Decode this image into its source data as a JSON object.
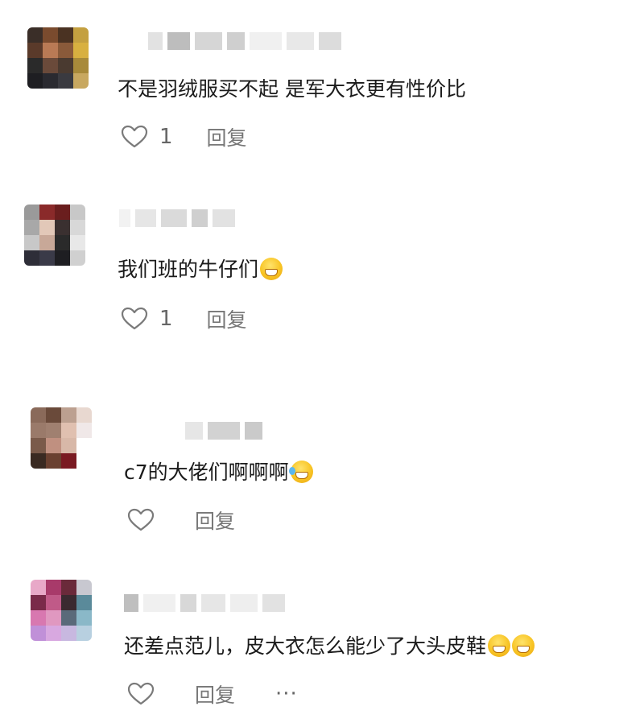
{
  "comments": [
    {
      "text": "不是羽绒服买不起 是军大衣更有性价比",
      "emoji": "",
      "like_count": "1",
      "reply_label": "回复",
      "avatar_colors": [
        "#3a2e28",
        "#7a4b2e",
        "#4a3222",
        "#c4a040",
        "#5a3a2a",
        "#b97a55",
        "#8a5a3a",
        "#d8b040",
        "#2a2a2a",
        "#6a4a3a",
        "#4a3a30",
        "#a88a3a",
        "#1e1e22",
        "#2a2a30",
        "#3a3a40",
        "#c8a860"
      ],
      "name_blocks": [
        "#e2e2e2",
        "#bdbdbd",
        "#d6d6d6",
        "#cfcfcf",
        "#f0f0f0",
        "#e8e8e8",
        "#dcdcdc"
      ]
    },
    {
      "text": "我们班的牛仔们",
      "emoji": "grin",
      "like_count": "1",
      "reply_label": "回复",
      "avatar_colors": [
        "#9a9a9a",
        "#8a2a2a",
        "#6a1e1e",
        "#c8c8c8",
        "#a8a8a8",
        "#e2c8b8",
        "#3a3030",
        "#d8d8d8",
        "#c8c8c8",
        "#c8a898",
        "#2a2a2a",
        "#e8e8e8",
        "#2e2e38",
        "#3a3a48",
        "#1e1e22",
        "#d0d0d0"
      ],
      "name_blocks": [
        "#f2f2f2",
        "#e6e6e6",
        "#dadada",
        "#cfcfcf",
        "#e2e2e2"
      ]
    },
    {
      "text": "c7的大佬们啊啊啊",
      "emoji": "laugh",
      "like_count": "",
      "reply_label": "回复",
      "avatar_colors": [
        "#8a6a5a",
        "#6a4a3a",
        "#bca090",
        "#e8d8d0",
        "#9a7a6a",
        "#a08070",
        "#e0c0b0",
        "#f0e8e8",
        "#7a5a4a",
        "#c09080",
        "#d8b8a8",
        "#ffffff",
        "#3a2a22",
        "#6a4030",
        "#7a1a22",
        "#ffffff"
      ],
      "name_blocks": [
        "#e6e6e6",
        "#d2d2d2",
        "#cacaca"
      ]
    },
    {
      "text": "还差点范儿，皮大衣怎么能少了大头皮鞋",
      "emoji": "grin2",
      "like_count": "",
      "reply_label": "回复",
      "more_label": "···",
      "avatar_colors": [
        "#e8a8c8",
        "#a83a6a",
        "#6a2a3a",
        "#c8c8d0",
        "#7a2a4a",
        "#c05a88",
        "#3a2a30",
        "#5a8a9a",
        "#d878b0",
        "#e098c0",
        "#5a6a7a",
        "#8ab8c8",
        "#c090d8",
        "#d8a8e0",
        "#c8b8e0",
        "#b8d0e0"
      ],
      "name_blocks": [
        "#bfbfbf",
        "#f0f0f0",
        "#d8d8d8",
        "#e6e6e6",
        "#eeeeee",
        "#e2e2e2"
      ]
    }
  ]
}
